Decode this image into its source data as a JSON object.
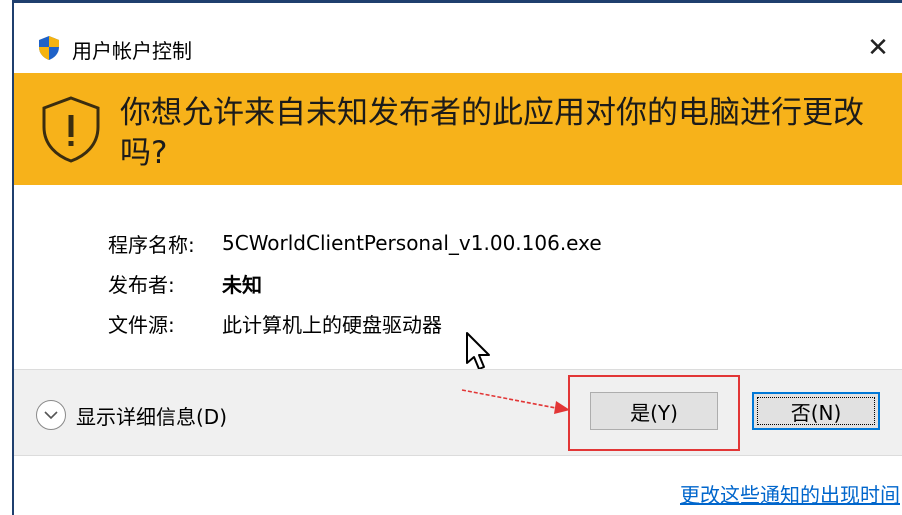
{
  "window": {
    "title": "用户帐户控制",
    "close_label": "✕"
  },
  "banner": {
    "question": "你想允许来自未知发布者的此应用对你的电脑进行更改吗?"
  },
  "details": {
    "rows": [
      {
        "label": "程序名称:",
        "value": "5CWorldClientPersonal_v1.00.106.exe",
        "bold": false
      },
      {
        "label": "发布者:",
        "value": "未知",
        "bold": true
      },
      {
        "label": "文件源:",
        "value": "此计算机上的硬盘驱动器",
        "bold": false
      }
    ]
  },
  "footer": {
    "show_details_label": "显示详细信息(D)",
    "yes_label": "是(Y)",
    "no_label": "否(N)"
  },
  "link": {
    "text": "更改这些通知的出现时间"
  },
  "colors": {
    "banner": "#f7b21a",
    "annotation": "#e23636",
    "link": "#0066cc"
  },
  "icons": [
    "shield-icon",
    "warning-shield-icon",
    "chevron-down-icon",
    "close-icon",
    "cursor-icon",
    "annotation-arrow"
  ]
}
